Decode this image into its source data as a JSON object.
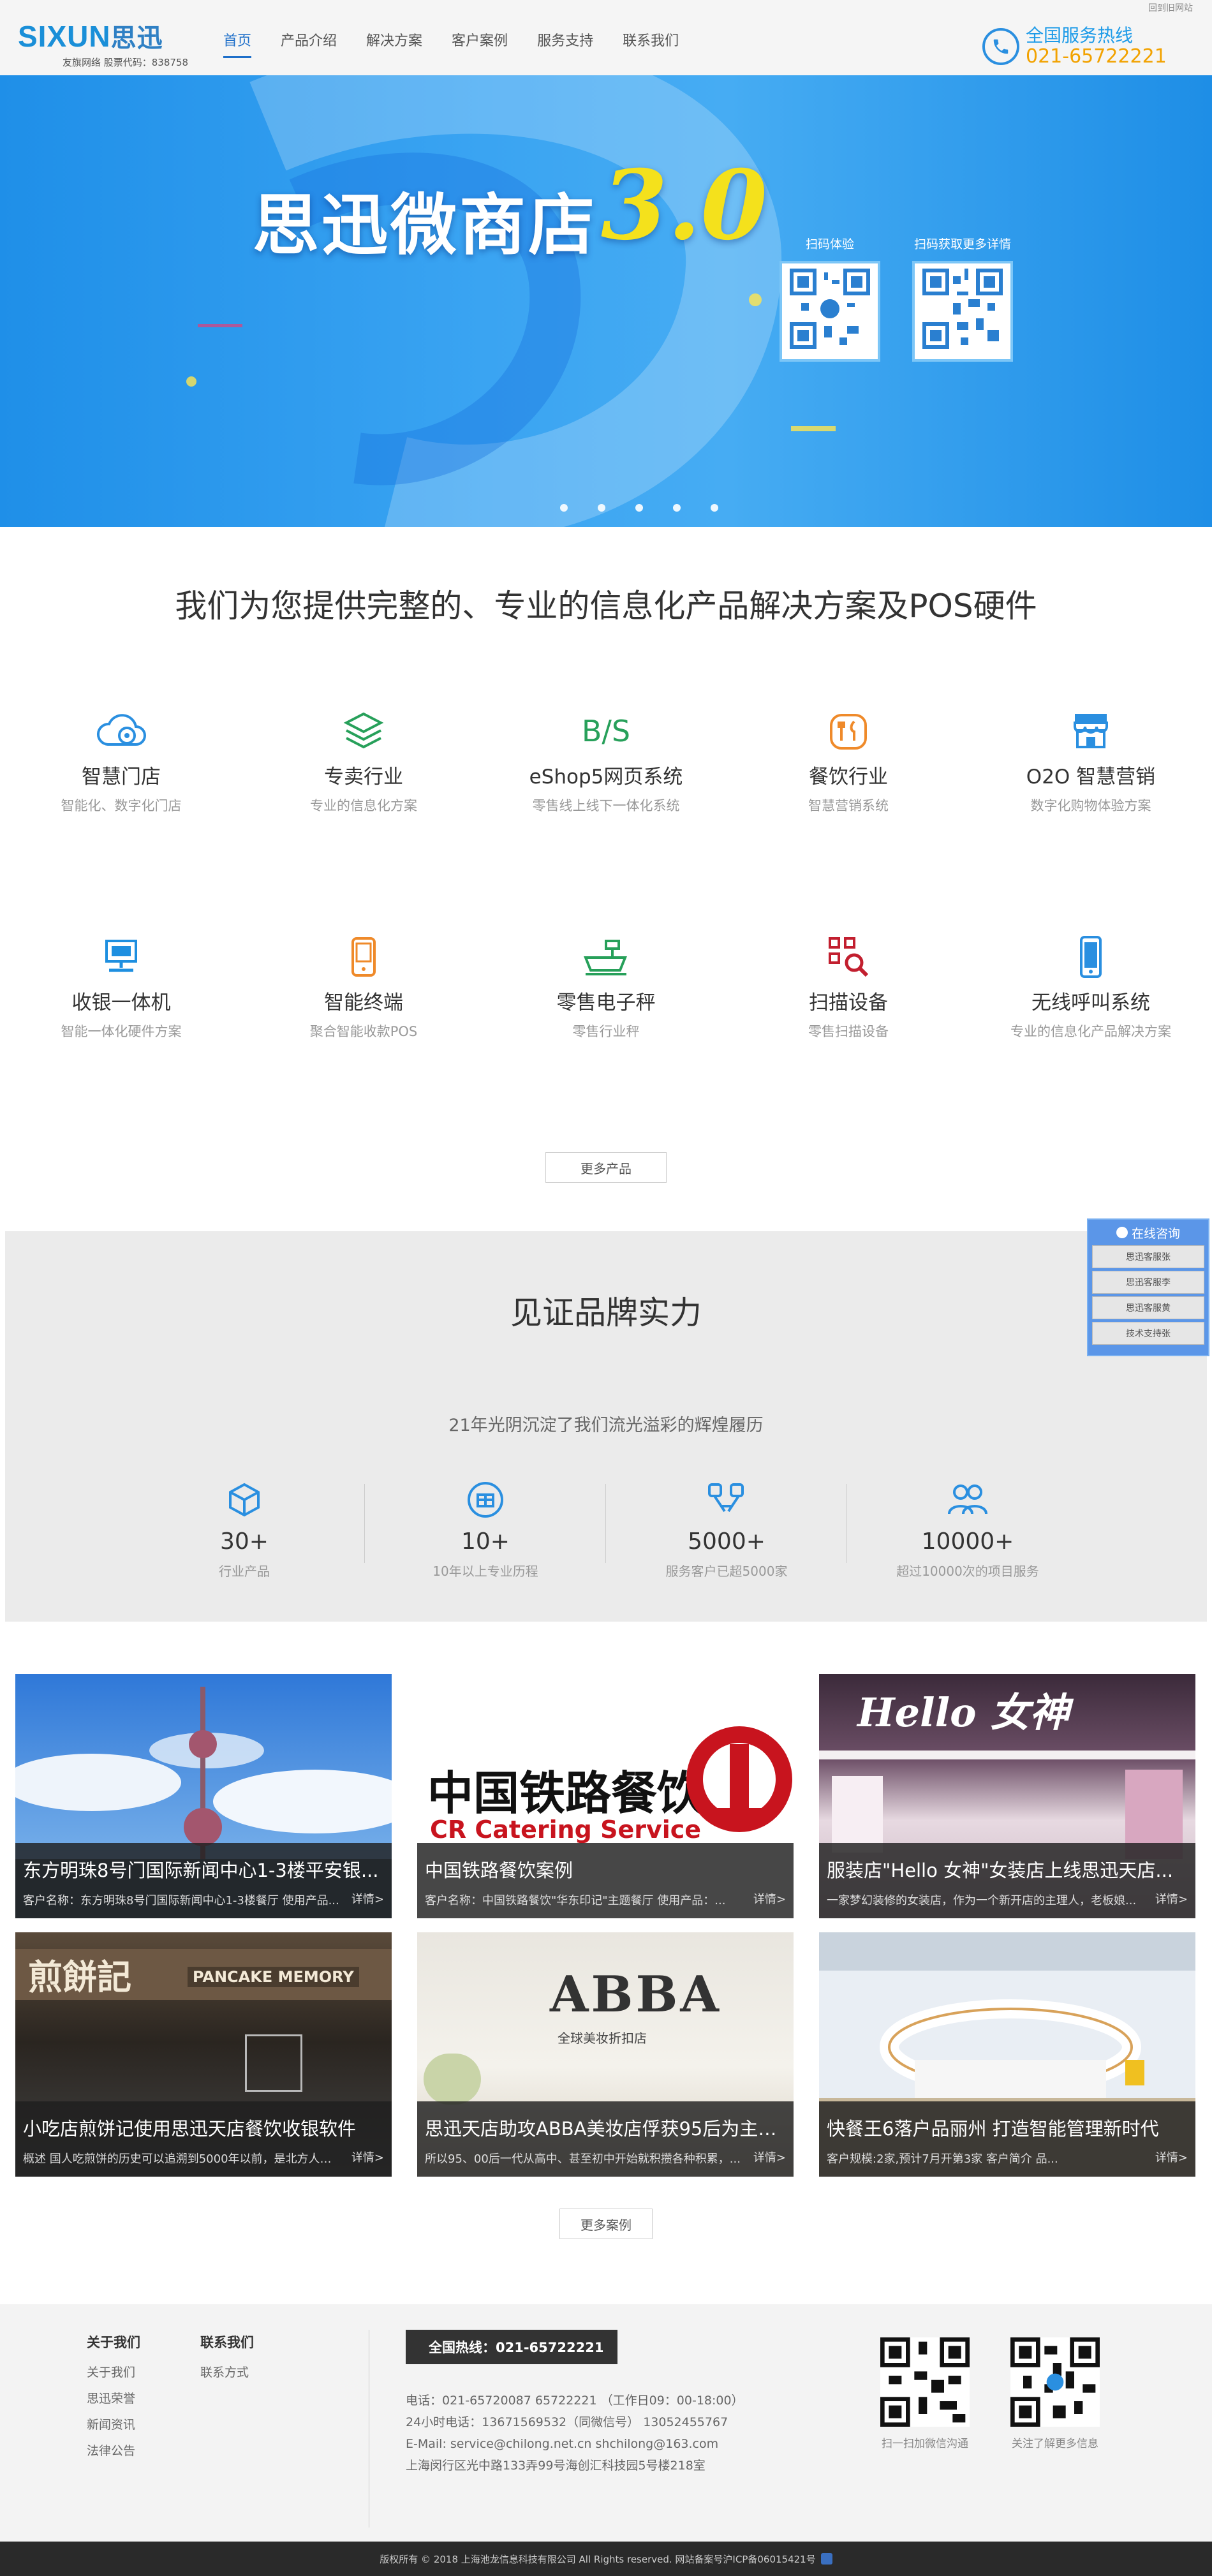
{
  "header": {
    "back_old": "回到旧网站",
    "logo_text": "SIXUN",
    "logo_cn": "思迅",
    "logo_sub": "友旗网络 股票代码：838758",
    "nav": [
      "首页",
      "产品介绍",
      "解决方案",
      "客户案例",
      "服务支持",
      "联系我们"
    ],
    "hotline_title": "全国服务热线",
    "hotline_number": "021-65722221"
  },
  "banner": {
    "title": "思迅微商店",
    "version": "3.0",
    "qr_left_label": "扫码体验",
    "qr_right_label": "扫码获取更多详情",
    "slides": 5
  },
  "solutions": {
    "title": "我们为您提供完整的、专业的信息化产品解决方案及POS硬件",
    "items": [
      {
        "name": "智慧门店",
        "desc": "智能化、数字化门店",
        "icon": "cloud-gear-icon"
      },
      {
        "name": "专卖行业",
        "desc": "专业的信息化方案",
        "icon": "layers-icon"
      },
      {
        "name": "eShop5网页系统",
        "desc": "零售线上线下一体化系统",
        "icon": "bs-icon",
        "icon_text": "B/S"
      },
      {
        "name": "餐饮行业",
        "desc": "智慧营销系统",
        "icon": "restaurant-icon"
      },
      {
        "name": "O2O 智慧营销",
        "desc": "数字化购物体验方案",
        "icon": "store-icon"
      },
      {
        "name": "收银一体机",
        "desc": "智能一体化硬件方案",
        "icon": "pos-monitor-icon"
      },
      {
        "name": "智能终端",
        "desc": "聚合智能收款POS",
        "icon": "terminal-icon"
      },
      {
        "name": "零售电子秤",
        "desc": "零售行业秤",
        "icon": "scale-icon"
      },
      {
        "name": "扫描设备",
        "desc": "零售扫描设备",
        "icon": "qr-scan-icon"
      },
      {
        "name": "无线呼叫系统",
        "desc": "专业的信息化产品解决方案",
        "icon": "phone-icon"
      }
    ],
    "more": "更多产品"
  },
  "brand": {
    "title": "见证品牌实力",
    "subtitle": "21年光阴沉淀了我们流光溢彩的辉煌履历",
    "stats": [
      {
        "value": "30+",
        "desc": "行业产品",
        "icon": "cube-icon"
      },
      {
        "value": "10+",
        "desc": "10年以上专业历程",
        "icon": "medal-icon"
      },
      {
        "value": "5000+",
        "desc": "服务客户已超5000家",
        "icon": "handshake-icon"
      },
      {
        "value": "10000+",
        "desc": "超过10000次的项目服务",
        "icon": "users-icon"
      }
    ]
  },
  "float_consult": {
    "title": "在线咨询",
    "items": [
      "思迅客服张",
      "思迅客服李",
      "思迅客服黄",
      "技术支持张"
    ]
  },
  "cases": {
    "items": [
      {
        "title": "东方明珠8号门国际新闻中心1-3楼平安银...",
        "desc": "客户名称：东方明珠8号门国际新闻中心1-3楼餐厅 使用产品...",
        "detail": "详情>"
      },
      {
        "title": "中国铁路餐饮案例",
        "desc": "客户名称：中国铁路餐饮\"华东印记\"主题餐厅 使用产品：...",
        "detail": "详情>",
        "image_text": "中国铁路餐饮",
        "image_sub": "CR Catering Service"
      },
      {
        "title": "服装店\"Hello 女神\"女装店上线思迅天店...",
        "desc": "一家梦幻装修的女装店，作为一个新开店的主理人，老板娘...",
        "detail": "详情>",
        "image_text": "Hello 女神"
      },
      {
        "title": "小吃店煎饼记使用思迅天店餐饮收银软件",
        "desc": "概述 国人吃煎饼的历史可以追溯到5000年以前，是北方人的...",
        "detail": "详情>",
        "image_text": "煎餅記",
        "image_sub": "PANCAKE MEMORY"
      },
      {
        "title": "思迅天店助攻ABBA美妆店俘获95后为主力...",
        "desc": "所以95、00后一代从高中、甚至初中开始就积攒各种积累，...",
        "detail": "详情>",
        "image_text": "ABBA",
        "image_sub": "全球美妆折扣店"
      },
      {
        "title": "快餐王6落户品丽州 打造智能管理新时代",
        "desc": "客户规模:2家,预计7月开第3家 客户简介 品...",
        "detail": "详情>"
      }
    ],
    "more": "更多案例"
  },
  "footer": {
    "about_title": "关于我们",
    "about_links": [
      "关于我们",
      "思迅荣誉",
      "新闻资讯",
      "法律公告"
    ],
    "contact_title": "联系我们",
    "contact_links": [
      "联系方式"
    ],
    "hotline": "全国热线：021-65722221",
    "info": [
      "电话：021-65720087 65722221 （工作日09：00-18:00）",
      "24小时电话：13671569532（同微信号） 13052455767",
      "E-Mail: service@chilong.net.cn shchilong@163.com",
      "上海闵行区光中路133弄99号海创汇科技园5号楼218室"
    ],
    "qr1_label": "扫一扫加微信沟通",
    "qr2_label": "关注了解更多信息",
    "copyright": "版权所有 © 2018 上海池龙信息科技有限公司 All Rights reserved. 网站备案号沪ICP备06015421号"
  }
}
